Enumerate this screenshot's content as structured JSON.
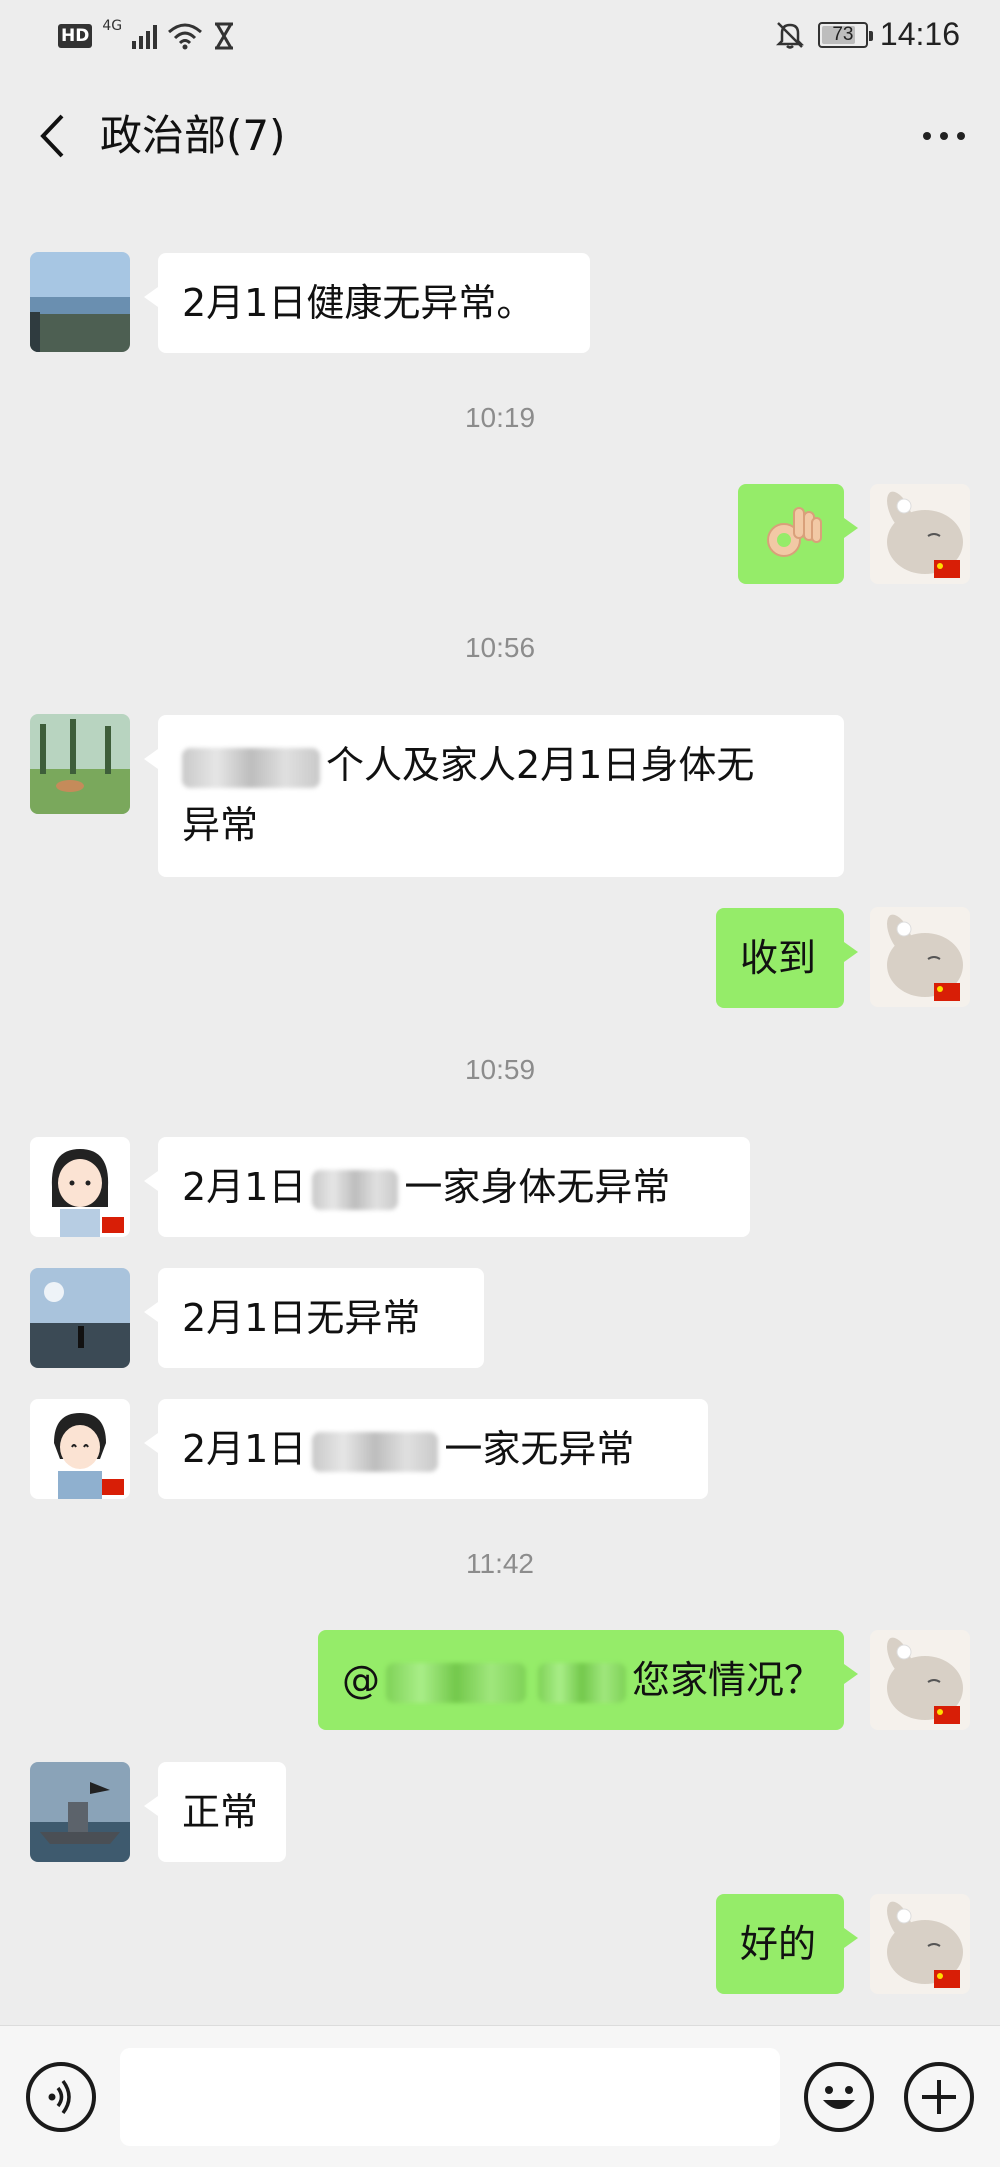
{
  "status_bar": {
    "hd_badge": "HD",
    "network": "4G",
    "battery_level": "73",
    "time": "14:16"
  },
  "header": {
    "title": "政治部(7)"
  },
  "messages": {
    "m1": {
      "text": "2月1日健康无异常。"
    },
    "ts1": "10:19",
    "m2": {
      "emoji": "ok-hand"
    },
    "ts2": "10:56",
    "m3": {
      "text_line1_after_redaction": "个人及家人2月1日身体无",
      "text_line2": "异常"
    },
    "m4": {
      "text": "收到"
    },
    "ts3": "10:59",
    "m5": {
      "text_prefix": "2月1日",
      "text_suffix": "一家身体无异常"
    },
    "m6": {
      "text": "2月1日无异常"
    },
    "m7": {
      "text_prefix": "2月1日",
      "text_suffix": "一家无异常"
    },
    "ts4": "11:42",
    "m8": {
      "text_prefix": "@",
      "text_suffix": "您家情况？"
    },
    "m9": {
      "text": "正常"
    },
    "m10": {
      "text": "好的"
    }
  },
  "colors": {
    "outgoing_bubble": "#95ec69",
    "incoming_bubble": "#ffffff",
    "chat_background": "#ededed"
  },
  "icons": {
    "back": "chevron-left-icon",
    "more": "more-dots-icon",
    "voice": "voice-icon",
    "emoji": "emoji-icon",
    "plus": "plus-icon"
  }
}
